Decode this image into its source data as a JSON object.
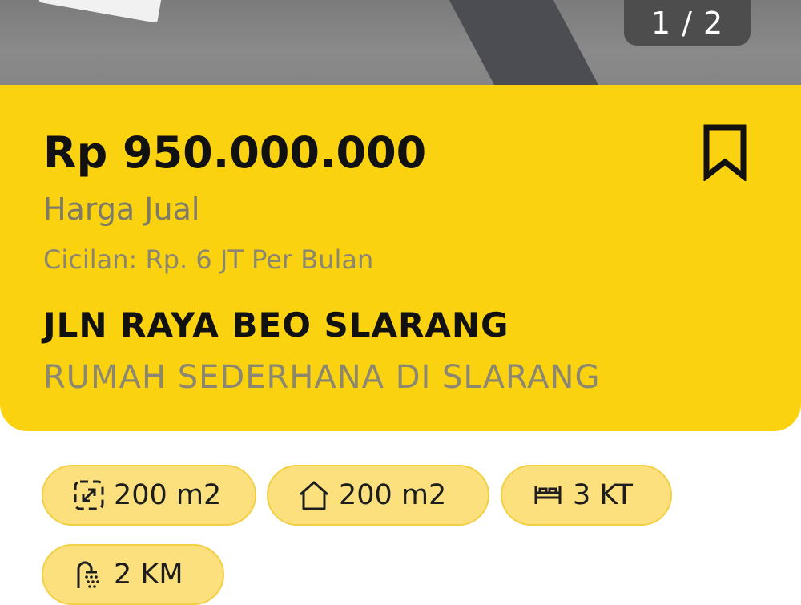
{
  "gallery": {
    "counter": "1 / 2"
  },
  "listing": {
    "price": "Rp 950.000.000",
    "price_label": "Harga Jual",
    "installment": "Cicilan: Rp. 6 JT Per Bulan",
    "street": "JLN RAYA BEO SLARANG",
    "description": "RUMAH SEDERHANA DI SLARANG",
    "bookmark_icon": "bookmark-icon"
  },
  "features": [
    {
      "icon": "land-area-icon",
      "value": "200 m2"
    },
    {
      "icon": "house-icon",
      "value": "200 m2"
    },
    {
      "icon": "bed-icon",
      "value": "3 KT"
    },
    {
      "icon": "shower-icon",
      "value": "2 KM"
    }
  ],
  "colors": {
    "card": "#fbd20f",
    "chip": "#fbe07d",
    "text": "#111111",
    "muted": "#8c8770"
  }
}
